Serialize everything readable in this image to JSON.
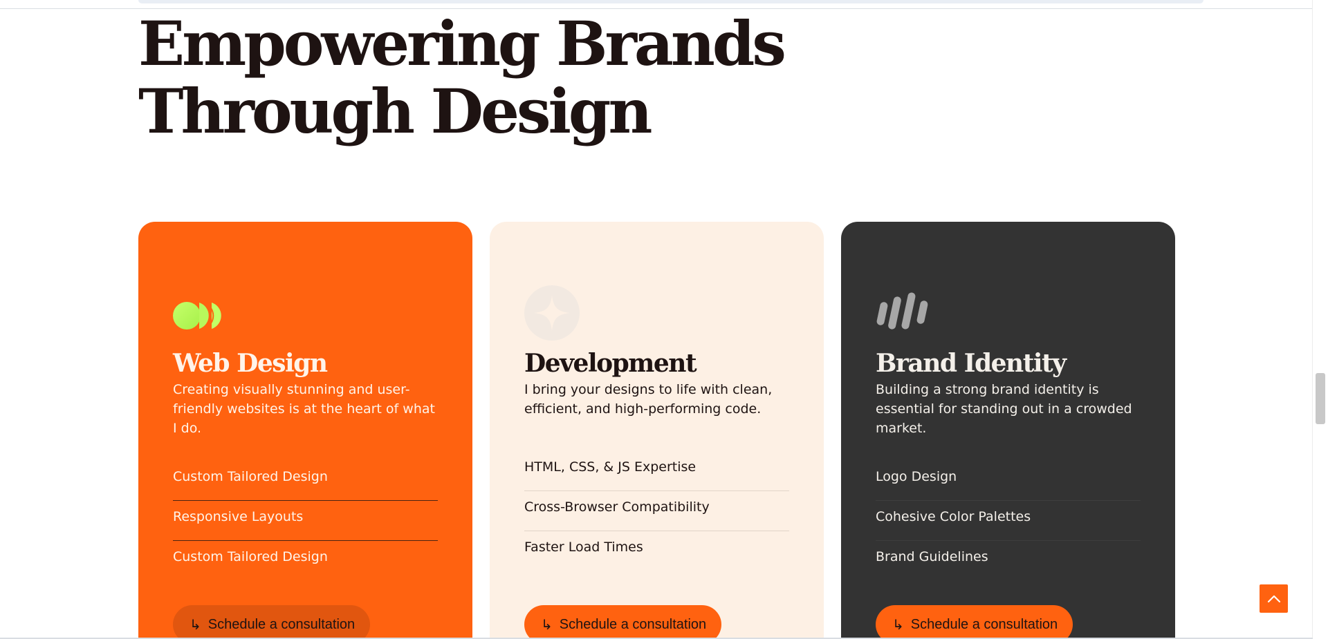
{
  "heading": {
    "line1": "Empowering Brands",
    "line2": "Through Design"
  },
  "colors": {
    "accent": "#ff6210",
    "dark": "#333333",
    "cream": "#fdf0e4",
    "text_dark": "#1e1312",
    "icon_green": "#b4ff55"
  },
  "cards": [
    {
      "icon": "overlapping-circles-icon",
      "title": "Web Design",
      "description": "Creating visually stunning and user-friendly websites is at the heart of what I do.",
      "features": [
        "Custom Tailored Design",
        "Responsive Layouts",
        "Custom Tailored Design"
      ],
      "cta_label": "Schedule a consultation",
      "cta_icon": "return-arrow-icon"
    },
    {
      "icon": "four-point-star-icon",
      "title": "Development",
      "description": "I bring your designs to life with clean, efficient, and high-performing code.",
      "features": [
        "HTML, CSS, & JS Expertise",
        "Cross-Browser Compatibility",
        "Faster Load Times"
      ],
      "cta_label": "Schedule a consultation",
      "cta_icon": "return-arrow-icon"
    },
    {
      "icon": "slanted-bars-icon",
      "title": "Brand Identity",
      "description": "Building a strong brand identity is essential for standing out in a crowded market.",
      "features": [
        "Logo Design",
        "Cohesive Color Palettes",
        "Brand Guidelines"
      ],
      "cta_label": "Schedule a consultation",
      "cta_icon": "return-arrow-icon"
    }
  ],
  "back_to_top_icon": "chevron-up-icon",
  "cta_arrow_glyph": "↳"
}
